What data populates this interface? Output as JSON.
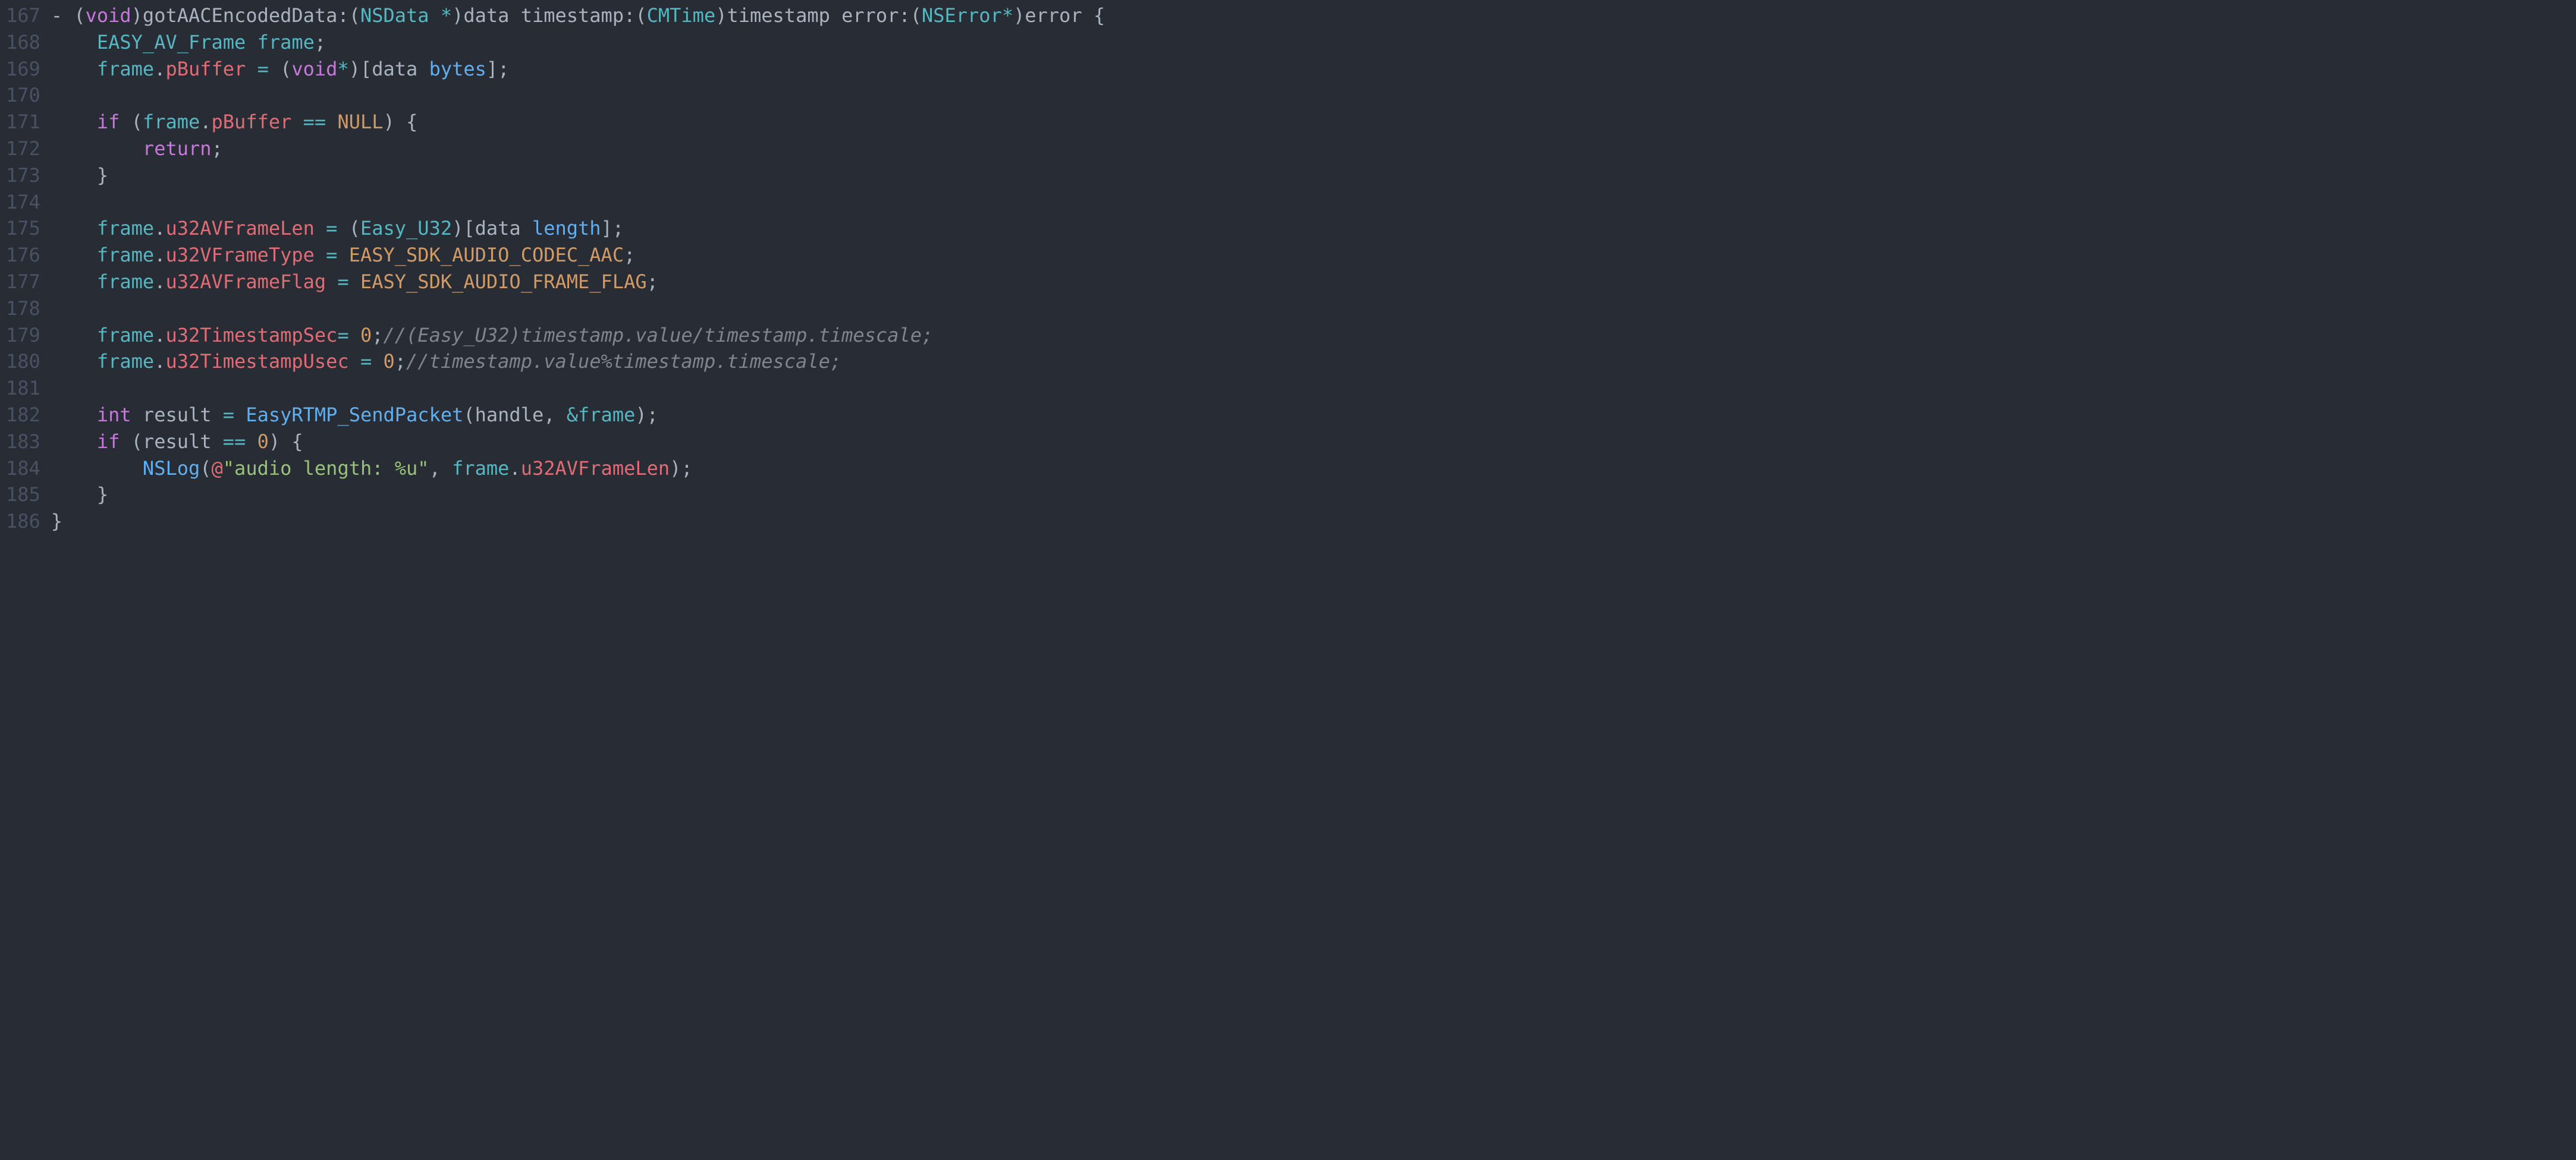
{
  "gutter": {
    "start": 167,
    "end": 186
  },
  "code": {
    "lines": [
      [
        {
          "cls": "tok-punct",
          "t": "- ("
        },
        {
          "cls": "tok-keyword",
          "t": "void"
        },
        {
          "cls": "tok-punct",
          "t": ")gotAACEncodedData:("
        },
        {
          "cls": "tok-type",
          "t": "NSData"
        },
        {
          "cls": "tok-punct",
          "t": " "
        },
        {
          "cls": "tok-op",
          "t": "*"
        },
        {
          "cls": "tok-punct",
          "t": ")data timestamp:("
        },
        {
          "cls": "tok-type",
          "t": "CMTime"
        },
        {
          "cls": "tok-punct",
          "t": ")timestamp error:("
        },
        {
          "cls": "tok-type",
          "t": "NSError"
        },
        {
          "cls": "tok-op",
          "t": "*"
        },
        {
          "cls": "tok-punct",
          "t": ")error {"
        }
      ],
      [
        {
          "cls": "tok-punct",
          "t": "    "
        },
        {
          "cls": "tok-type",
          "t": "EASY_AV_Frame"
        },
        {
          "cls": "tok-punct",
          "t": " "
        },
        {
          "cls": "tok-type",
          "t": "frame"
        },
        {
          "cls": "tok-punct",
          "t": ";"
        }
      ],
      [
        {
          "cls": "tok-punct",
          "t": "    "
        },
        {
          "cls": "tok-type",
          "t": "frame"
        },
        {
          "cls": "tok-punct",
          "t": "."
        },
        {
          "cls": "tok-prop",
          "t": "pBuffer"
        },
        {
          "cls": "tok-punct",
          "t": " "
        },
        {
          "cls": "tok-op",
          "t": "="
        },
        {
          "cls": "tok-punct",
          "t": " ("
        },
        {
          "cls": "tok-keyword",
          "t": "void"
        },
        {
          "cls": "tok-op",
          "t": "*"
        },
        {
          "cls": "tok-punct",
          "t": ")[data "
        },
        {
          "cls": "tok-msg",
          "t": "bytes"
        },
        {
          "cls": "tok-punct",
          "t": "];"
        }
      ],
      [],
      [
        {
          "cls": "tok-punct",
          "t": "    "
        },
        {
          "cls": "tok-keyword",
          "t": "if"
        },
        {
          "cls": "tok-punct",
          "t": " ("
        },
        {
          "cls": "tok-type",
          "t": "frame"
        },
        {
          "cls": "tok-punct",
          "t": "."
        },
        {
          "cls": "tok-prop",
          "t": "pBuffer"
        },
        {
          "cls": "tok-punct",
          "t": " "
        },
        {
          "cls": "tok-op",
          "t": "=="
        },
        {
          "cls": "tok-punct",
          "t": " "
        },
        {
          "cls": "tok-const",
          "t": "NULL"
        },
        {
          "cls": "tok-punct",
          "t": ") {"
        }
      ],
      [
        {
          "cls": "tok-punct",
          "t": "        "
        },
        {
          "cls": "tok-keyword",
          "t": "return"
        },
        {
          "cls": "tok-punct",
          "t": ";"
        }
      ],
      [
        {
          "cls": "tok-punct",
          "t": "    }"
        }
      ],
      [],
      [
        {
          "cls": "tok-punct",
          "t": "    "
        },
        {
          "cls": "tok-type",
          "t": "frame"
        },
        {
          "cls": "tok-punct",
          "t": "."
        },
        {
          "cls": "tok-prop",
          "t": "u32AVFrameLen"
        },
        {
          "cls": "tok-punct",
          "t": " "
        },
        {
          "cls": "tok-op",
          "t": "="
        },
        {
          "cls": "tok-punct",
          "t": " ("
        },
        {
          "cls": "tok-type",
          "t": "Easy_U32"
        },
        {
          "cls": "tok-punct",
          "t": ")[data "
        },
        {
          "cls": "tok-msg",
          "t": "length"
        },
        {
          "cls": "tok-punct",
          "t": "];"
        }
      ],
      [
        {
          "cls": "tok-punct",
          "t": "    "
        },
        {
          "cls": "tok-type",
          "t": "frame"
        },
        {
          "cls": "tok-punct",
          "t": "."
        },
        {
          "cls": "tok-prop",
          "t": "u32VFrameType"
        },
        {
          "cls": "tok-punct",
          "t": " "
        },
        {
          "cls": "tok-op",
          "t": "="
        },
        {
          "cls": "tok-punct",
          "t": " "
        },
        {
          "cls": "tok-const",
          "t": "EASY_SDK_AUDIO_CODEC_AAC"
        },
        {
          "cls": "tok-punct",
          "t": ";"
        }
      ],
      [
        {
          "cls": "tok-punct",
          "t": "    "
        },
        {
          "cls": "tok-type",
          "t": "frame"
        },
        {
          "cls": "tok-punct",
          "t": "."
        },
        {
          "cls": "tok-prop",
          "t": "u32AVFrameFlag"
        },
        {
          "cls": "tok-punct",
          "t": " "
        },
        {
          "cls": "tok-op",
          "t": "="
        },
        {
          "cls": "tok-punct",
          "t": " "
        },
        {
          "cls": "tok-const",
          "t": "EASY_SDK_AUDIO_FRAME_FLAG"
        },
        {
          "cls": "tok-punct",
          "t": ";"
        }
      ],
      [],
      [
        {
          "cls": "tok-punct",
          "t": "    "
        },
        {
          "cls": "tok-type",
          "t": "frame"
        },
        {
          "cls": "tok-punct",
          "t": "."
        },
        {
          "cls": "tok-prop",
          "t": "u32TimestampSec"
        },
        {
          "cls": "tok-op",
          "t": "="
        },
        {
          "cls": "tok-punct",
          "t": " "
        },
        {
          "cls": "tok-const",
          "t": "0"
        },
        {
          "cls": "tok-punct",
          "t": ";"
        },
        {
          "cls": "tok-comment",
          "t": "//(Easy_U32)timestamp.value/timestamp.timescale;"
        }
      ],
      [
        {
          "cls": "tok-punct",
          "t": "    "
        },
        {
          "cls": "tok-type",
          "t": "frame"
        },
        {
          "cls": "tok-punct",
          "t": "."
        },
        {
          "cls": "tok-prop",
          "t": "u32TimestampUsec"
        },
        {
          "cls": "tok-punct",
          "t": " "
        },
        {
          "cls": "tok-op",
          "t": "="
        },
        {
          "cls": "tok-punct",
          "t": " "
        },
        {
          "cls": "tok-const",
          "t": "0"
        },
        {
          "cls": "tok-punct",
          "t": ";"
        },
        {
          "cls": "tok-comment",
          "t": "//timestamp.value%timestamp.timescale;"
        }
      ],
      [],
      [
        {
          "cls": "tok-punct",
          "t": "    "
        },
        {
          "cls": "tok-keyword",
          "t": "int"
        },
        {
          "cls": "tok-punct",
          "t": " result "
        },
        {
          "cls": "tok-op",
          "t": "="
        },
        {
          "cls": "tok-punct",
          "t": " "
        },
        {
          "cls": "tok-func",
          "t": "EasyRTMP_SendPacket"
        },
        {
          "cls": "tok-punct",
          "t": "(handle, "
        },
        {
          "cls": "tok-op",
          "t": "&"
        },
        {
          "cls": "tok-type",
          "t": "frame"
        },
        {
          "cls": "tok-punct",
          "t": ");"
        }
      ],
      [
        {
          "cls": "tok-punct",
          "t": "    "
        },
        {
          "cls": "tok-keyword",
          "t": "if"
        },
        {
          "cls": "tok-punct",
          "t": " (result "
        },
        {
          "cls": "tok-op",
          "t": "=="
        },
        {
          "cls": "tok-punct",
          "t": " "
        },
        {
          "cls": "tok-const",
          "t": "0"
        },
        {
          "cls": "tok-punct",
          "t": ") {"
        }
      ],
      [
        {
          "cls": "tok-punct",
          "t": "        "
        },
        {
          "cls": "tok-func",
          "t": "NSLog"
        },
        {
          "cls": "tok-punct",
          "t": "("
        },
        {
          "cls": "tok-prop",
          "t": "@"
        },
        {
          "cls": "tok-string",
          "t": "\"audio length: %u\""
        },
        {
          "cls": "tok-punct",
          "t": ", "
        },
        {
          "cls": "tok-type",
          "t": "frame"
        },
        {
          "cls": "tok-punct",
          "t": "."
        },
        {
          "cls": "tok-prop",
          "t": "u32AVFrameLen"
        },
        {
          "cls": "tok-punct",
          "t": ");"
        }
      ],
      [
        {
          "cls": "tok-punct",
          "t": "    }"
        }
      ],
      [
        {
          "cls": "tok-punct",
          "t": "}"
        }
      ]
    ]
  }
}
